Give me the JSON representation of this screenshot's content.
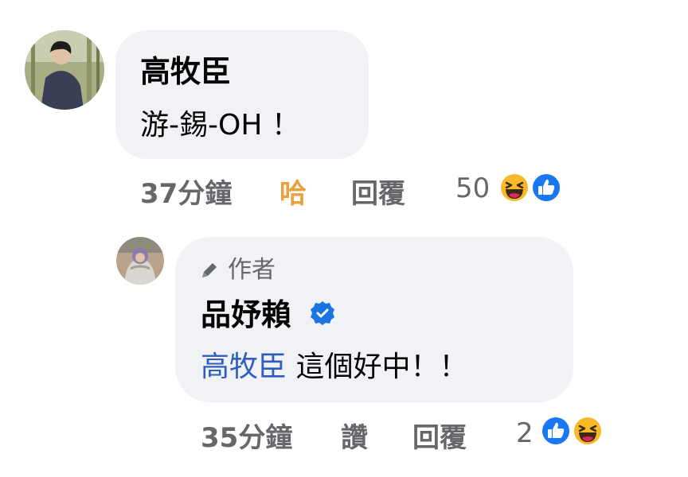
{
  "comments": [
    {
      "author": "高牧臣",
      "text": "游-錫-OH ！",
      "time": "37分鐘",
      "reaction_label": "哈",
      "reply_label": "回覆",
      "reaction_count": "50",
      "reaction_icons": [
        "haha-icon",
        "like-icon"
      ]
    }
  ],
  "reply": {
    "author_badge": "作者",
    "author": "品妤賴",
    "mention": "高牧臣",
    "text": " 這個好中！！",
    "time": "35分鐘",
    "like_label": "讚",
    "reply_label": "回覆",
    "reaction_count": "2",
    "reaction_icons": [
      "like-icon",
      "haha-icon"
    ]
  },
  "colors": {
    "bubble": "#f0f2f5",
    "secondary_text": "#65676b",
    "haha_label": "#e9a23b",
    "mention": "#2f5cbf",
    "like_blue": "#1877f2",
    "verified_blue": "#1b74e4"
  }
}
